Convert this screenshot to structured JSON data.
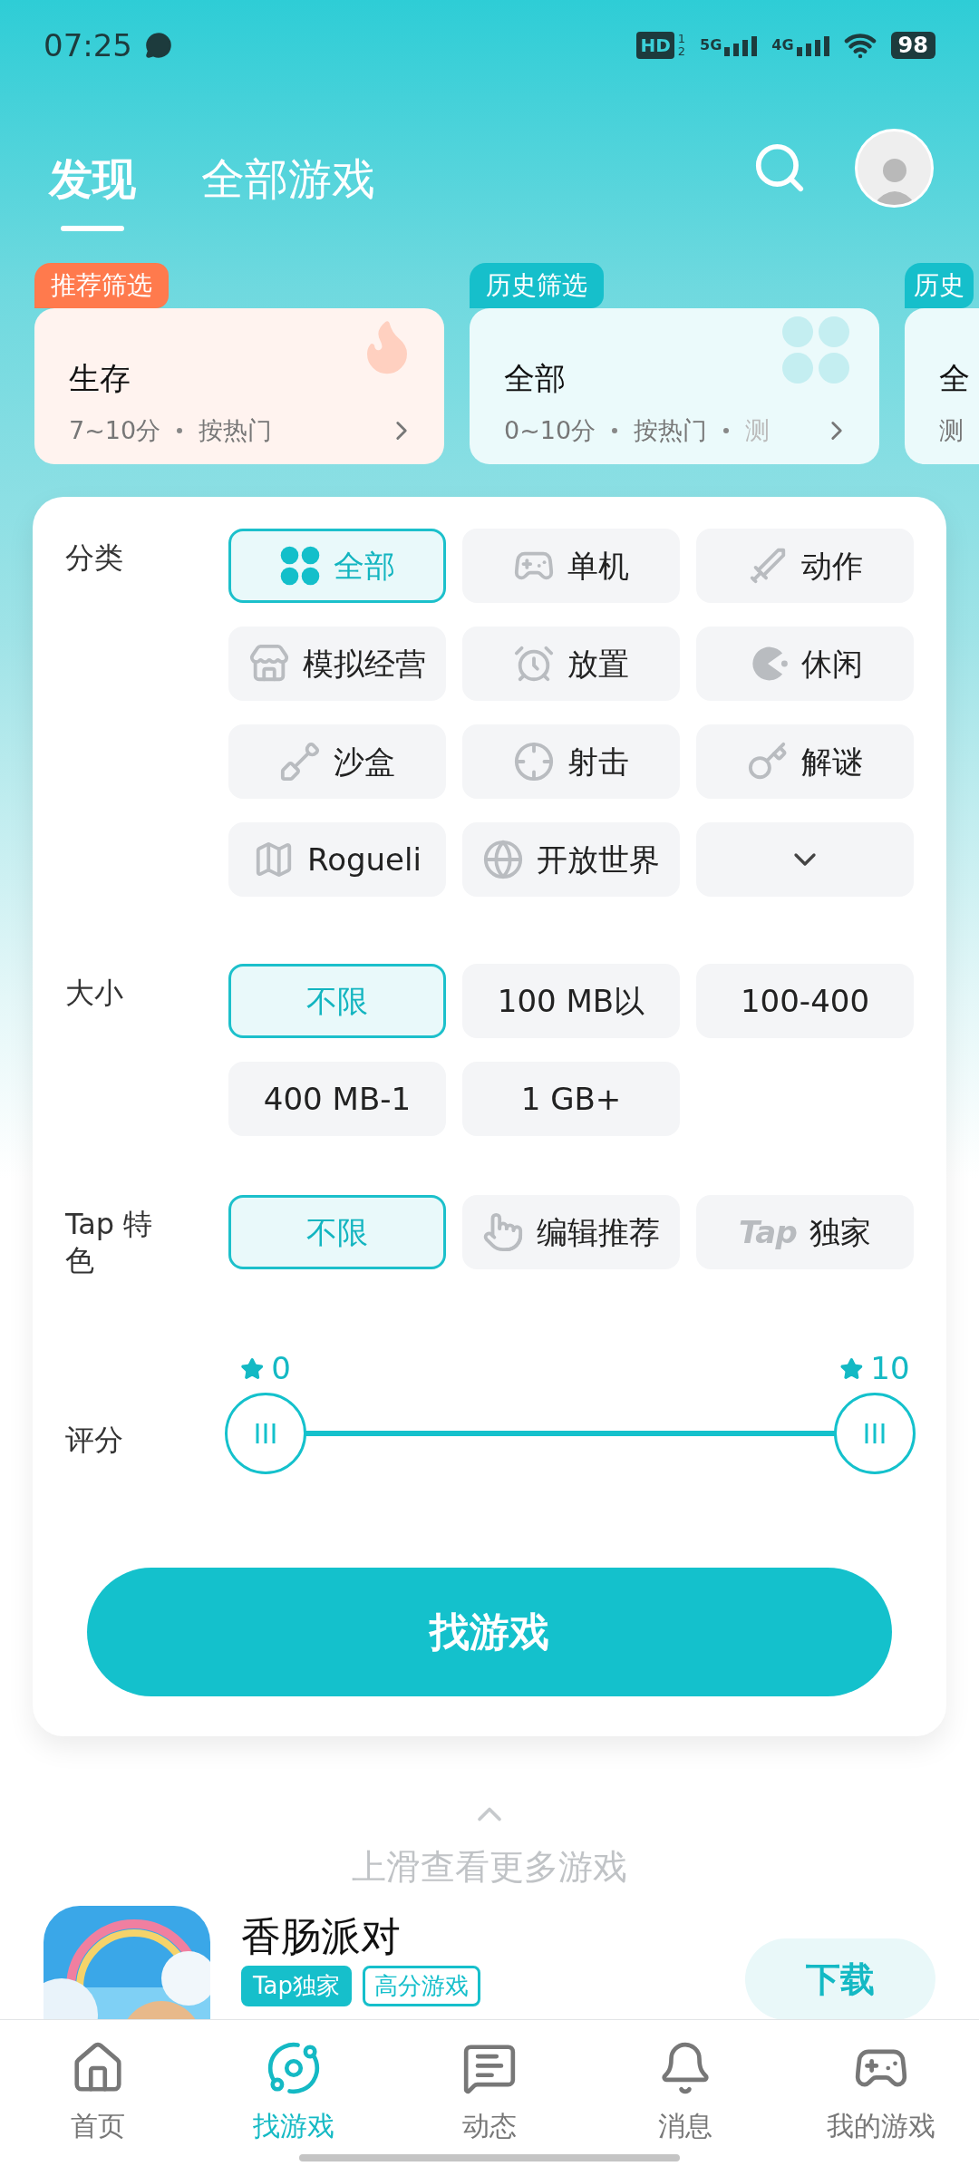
{
  "status_bar": {
    "time": "07:25",
    "hd": "HD",
    "hd_slots": [
      "1",
      "2"
    ],
    "networks": [
      "5G",
      "4G"
    ],
    "battery": "98"
  },
  "tabs": [
    {
      "label": "发现",
      "selected": true
    },
    {
      "label": "全部游戏",
      "selected": false
    }
  ],
  "presets": [
    {
      "badge": "推荐筛选",
      "kind": "recommended",
      "title": "生存",
      "details": [
        "7~10分",
        "按热门"
      ]
    },
    {
      "badge": "历史筛选",
      "kind": "history",
      "title": "全部",
      "details": [
        "0~10分",
        "按热门",
        "测"
      ]
    },
    {
      "badge": "历史",
      "kind": "cut",
      "title": "全",
      "details": [
        "测"
      ]
    }
  ],
  "filters": {
    "category": {
      "label": "分类",
      "options": [
        {
          "label": "全部",
          "selected": true,
          "kind": "icon"
        },
        {
          "label": "单机",
          "selected": false,
          "kind": "icon"
        },
        {
          "label": "动作",
          "selected": false,
          "kind": "icon"
        },
        {
          "label": "模拟经营",
          "selected": false,
          "kind": "icon"
        },
        {
          "label": "放置",
          "selected": false,
          "kind": "icon"
        },
        {
          "label": "休闲",
          "selected": false,
          "kind": "icon"
        },
        {
          "label": "沙盒",
          "selected": false,
          "kind": "icon"
        },
        {
          "label": "射击",
          "selected": false,
          "kind": "icon"
        },
        {
          "label": "解谜",
          "selected": false,
          "kind": "icon"
        },
        {
          "label": "Rogueli",
          "selected": false,
          "kind": "icon"
        },
        {
          "label": "开放世界",
          "selected": false,
          "kind": "icon"
        },
        {
          "kind": "more",
          "selected": false
        }
      ]
    },
    "size": {
      "label": "大小",
      "options": [
        {
          "label": "不限",
          "selected": true,
          "kind": "plain"
        },
        {
          "label": "100 MB以",
          "selected": false,
          "kind": "plain"
        },
        {
          "label": "100-400",
          "selected": false,
          "kind": "plain"
        },
        {
          "label": "400 MB-1",
          "selected": false,
          "kind": "plain"
        },
        {
          "label": "1 GB+",
          "selected": false,
          "kind": "plain"
        }
      ]
    },
    "feature": {
      "label": "Tap 特色",
      "options": [
        {
          "label": "不限",
          "selected": true,
          "kind": "plain"
        },
        {
          "label": "编辑推荐",
          "selected": false,
          "kind": "hand"
        },
        {
          "label": "独家",
          "logo": "Tap",
          "selected": false,
          "kind": "logo"
        }
      ]
    },
    "rating": {
      "label": "评分",
      "thumbs": [
        {
          "reading": "0",
          "level": 0
        },
        {
          "reading": "10",
          "level": 1
        }
      ]
    },
    "submit": "找游戏"
  },
  "more_hint": "上滑查看更多游戏",
  "game": {
    "name": "香肠派对",
    "tags": [
      "Tap独家",
      "高分游戏"
    ],
    "action": "下载"
  },
  "nav": [
    {
      "label": "首页",
      "selected": false
    },
    {
      "label": "找游戏",
      "selected": true
    },
    {
      "label": "动态",
      "selected": false
    },
    {
      "label": "消息",
      "selected": false
    },
    {
      "label": "我的游戏",
      "selected": false
    }
  ]
}
